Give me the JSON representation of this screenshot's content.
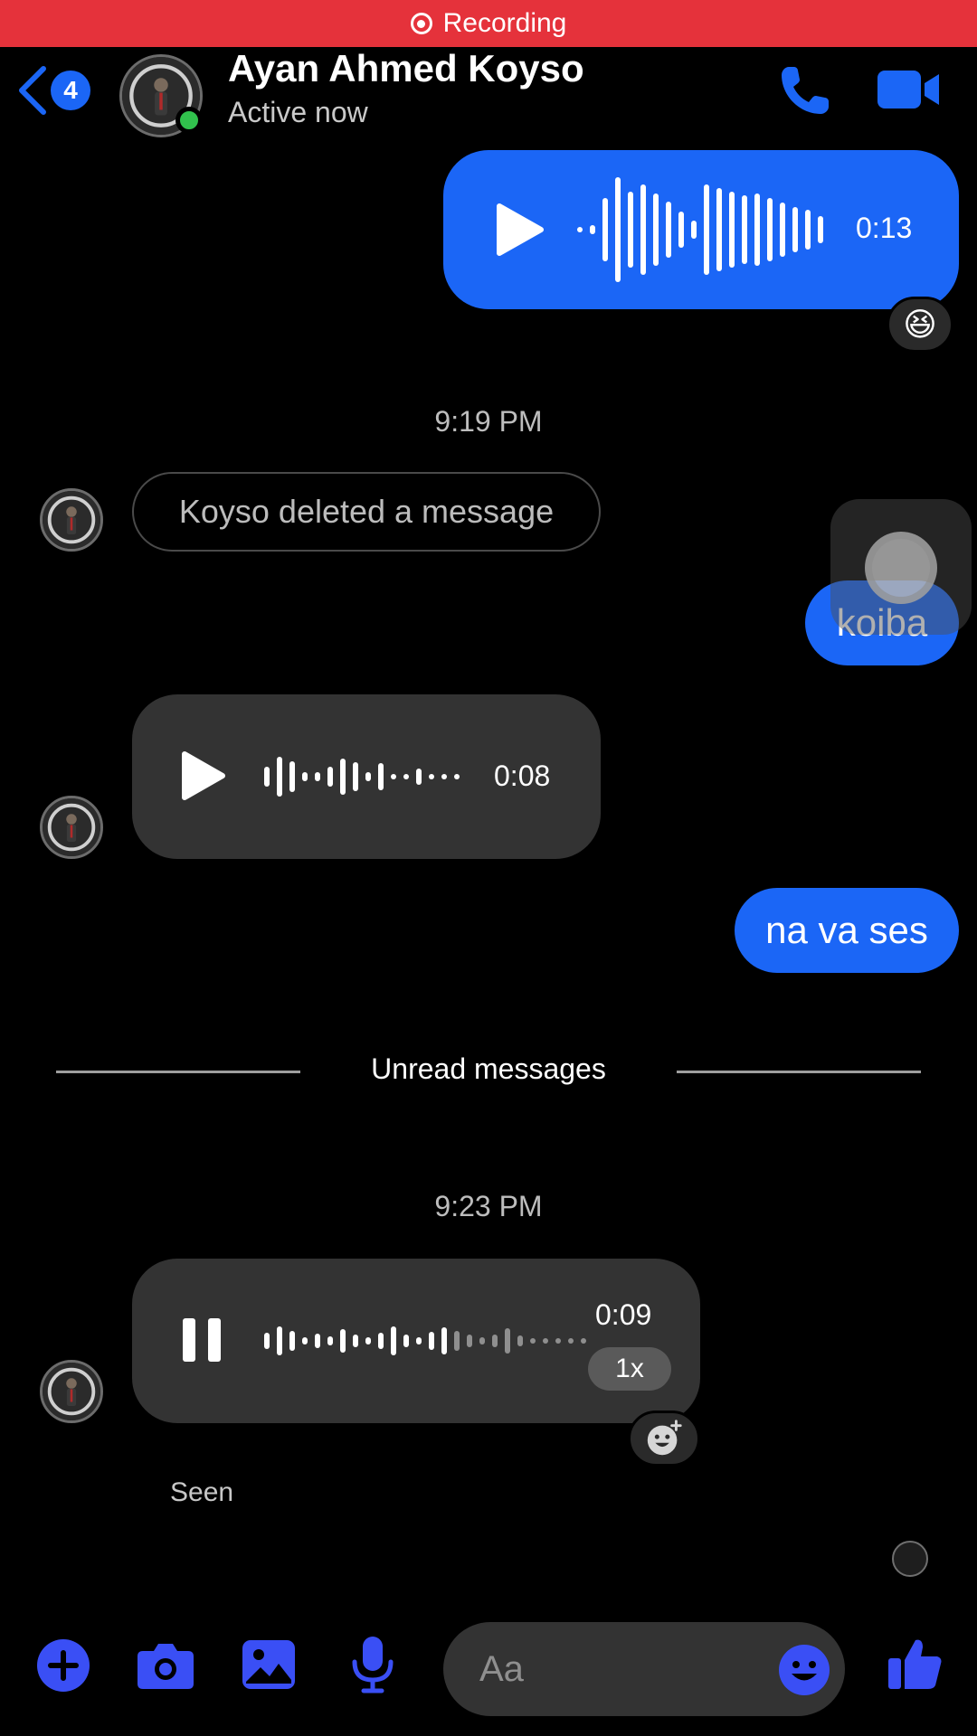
{
  "status_bar": {
    "recording_label": "Recording"
  },
  "header": {
    "back_badge": "4",
    "contact_name": "Ayan Ahmed Koyso",
    "status": "Active now"
  },
  "messages": {
    "voice1": {
      "duration": "0:13",
      "reaction": "😆"
    },
    "time1": "9:19 PM",
    "deleted": "Koyso deleted a message",
    "text_koiba": "koiba",
    "voice2": {
      "duration": "0:08"
    },
    "text_navases": "na va ses",
    "unread_divider": "Unread messages",
    "time2": "9:23 PM",
    "voice3": {
      "duration": "0:09",
      "speed": "1x"
    },
    "seen": "Seen"
  },
  "composer": {
    "placeholder": "Aa"
  },
  "colors": {
    "accent": "#1b66f6",
    "recording": "#e5323b",
    "bubble_gray": "#333333",
    "online": "#31c24d"
  }
}
